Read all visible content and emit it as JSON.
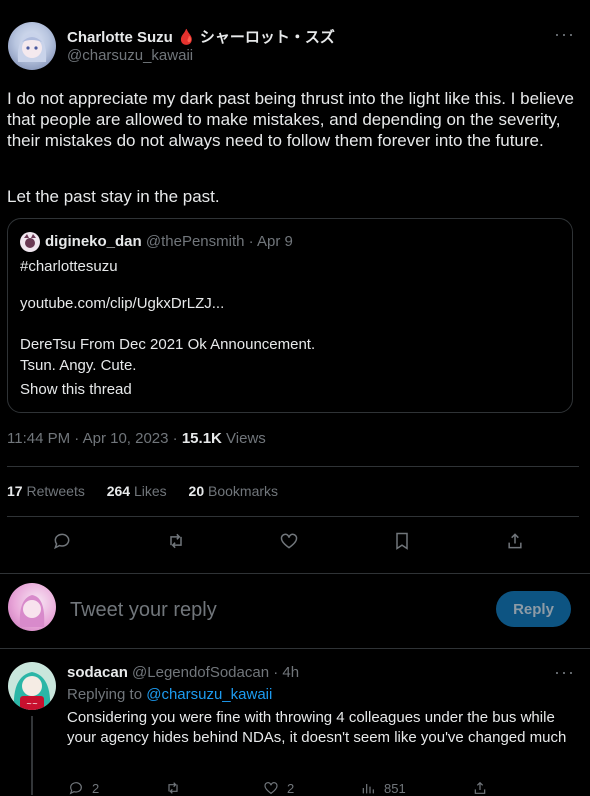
{
  "tweet": {
    "display_name": "Charlotte Suzu",
    "name_emoji": "🩸",
    "name_jp": "シャーロット・スズ",
    "handle": "@charsuzu_kawaii",
    "more_icon": "more-dots-icon",
    "text_p1": "I do not appreciate my dark past being thrust into the light like this. I believe that people are allowed to make mistakes, and depending on the severity, their mistakes do not always need to follow them forever into the future.",
    "text_p2": "Let the past stay in the past.",
    "quote": {
      "name": "digineko_dan",
      "handle": "@thePensmith",
      "dot": "·",
      "date": "Apr 9",
      "line1": "#charlottesuzu",
      "line2": "youtube.com/clip/UgkxDrLZJ...",
      "line3": "DereTsu From Dec 2021 Ok Announcement.",
      "line4": "Tsun. Angy. Cute.",
      "show_thread": "Show this thread"
    },
    "timestamp": "11:44 PM · Apr 10, 2023",
    "views_dot": "·",
    "views_count": "15.1K",
    "views_label": "Views",
    "retweets_count": "17",
    "retweets_label": "Retweets",
    "likes_count": "264",
    "likes_label": "Likes",
    "bookmarks_count": "20",
    "bookmarks_label": "Bookmarks"
  },
  "compose": {
    "placeholder": "Tweet your reply",
    "button": "Reply"
  },
  "reply": {
    "name": "sodacan",
    "handle": "@LegendofSodacan",
    "dot": "·",
    "time": "4h",
    "replying_to": "Replying to",
    "replying_handle": "@charsuzu_kawaii",
    "text": "Considering you were fine with throwing 4 colleagues under the bus while your agency hides behind NDAs, it doesn't seem like you've changed much",
    "reply_count": "2",
    "retweet_count": "",
    "like_count": "2",
    "view_count": "851"
  },
  "colors": {
    "background": "#000000",
    "text": "#e7e9ea",
    "muted": "#71767b",
    "accent": "#1d9bf0",
    "divider": "#2f3336"
  }
}
